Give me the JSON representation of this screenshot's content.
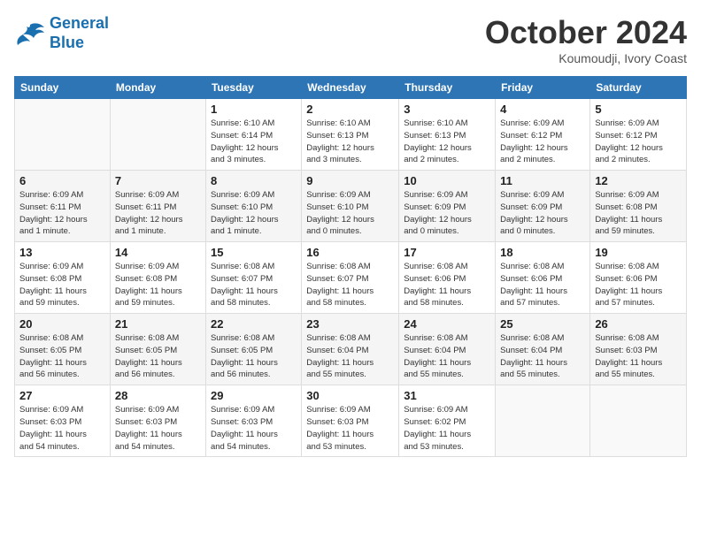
{
  "logo": {
    "line1": "General",
    "line2": "Blue"
  },
  "title": "October 2024",
  "subtitle": "Koumoudji, Ivory Coast",
  "days_of_week": [
    "Sunday",
    "Monday",
    "Tuesday",
    "Wednesday",
    "Thursday",
    "Friday",
    "Saturday"
  ],
  "weeks": [
    [
      {
        "day": "",
        "info": ""
      },
      {
        "day": "",
        "info": ""
      },
      {
        "day": "1",
        "info": "Sunrise: 6:10 AM\nSunset: 6:14 PM\nDaylight: 12 hours\nand 3 minutes."
      },
      {
        "day": "2",
        "info": "Sunrise: 6:10 AM\nSunset: 6:13 PM\nDaylight: 12 hours\nand 3 minutes."
      },
      {
        "day": "3",
        "info": "Sunrise: 6:10 AM\nSunset: 6:13 PM\nDaylight: 12 hours\nand 2 minutes."
      },
      {
        "day": "4",
        "info": "Sunrise: 6:09 AM\nSunset: 6:12 PM\nDaylight: 12 hours\nand 2 minutes."
      },
      {
        "day": "5",
        "info": "Sunrise: 6:09 AM\nSunset: 6:12 PM\nDaylight: 12 hours\nand 2 minutes."
      }
    ],
    [
      {
        "day": "6",
        "info": "Sunrise: 6:09 AM\nSunset: 6:11 PM\nDaylight: 12 hours\nand 1 minute."
      },
      {
        "day": "7",
        "info": "Sunrise: 6:09 AM\nSunset: 6:11 PM\nDaylight: 12 hours\nand 1 minute."
      },
      {
        "day": "8",
        "info": "Sunrise: 6:09 AM\nSunset: 6:10 PM\nDaylight: 12 hours\nand 1 minute."
      },
      {
        "day": "9",
        "info": "Sunrise: 6:09 AM\nSunset: 6:10 PM\nDaylight: 12 hours\nand 0 minutes."
      },
      {
        "day": "10",
        "info": "Sunrise: 6:09 AM\nSunset: 6:09 PM\nDaylight: 12 hours\nand 0 minutes."
      },
      {
        "day": "11",
        "info": "Sunrise: 6:09 AM\nSunset: 6:09 PM\nDaylight: 12 hours\nand 0 minutes."
      },
      {
        "day": "12",
        "info": "Sunrise: 6:09 AM\nSunset: 6:08 PM\nDaylight: 11 hours\nand 59 minutes."
      }
    ],
    [
      {
        "day": "13",
        "info": "Sunrise: 6:09 AM\nSunset: 6:08 PM\nDaylight: 11 hours\nand 59 minutes."
      },
      {
        "day": "14",
        "info": "Sunrise: 6:09 AM\nSunset: 6:08 PM\nDaylight: 11 hours\nand 59 minutes."
      },
      {
        "day": "15",
        "info": "Sunrise: 6:08 AM\nSunset: 6:07 PM\nDaylight: 11 hours\nand 58 minutes."
      },
      {
        "day": "16",
        "info": "Sunrise: 6:08 AM\nSunset: 6:07 PM\nDaylight: 11 hours\nand 58 minutes."
      },
      {
        "day": "17",
        "info": "Sunrise: 6:08 AM\nSunset: 6:06 PM\nDaylight: 11 hours\nand 58 minutes."
      },
      {
        "day": "18",
        "info": "Sunrise: 6:08 AM\nSunset: 6:06 PM\nDaylight: 11 hours\nand 57 minutes."
      },
      {
        "day": "19",
        "info": "Sunrise: 6:08 AM\nSunset: 6:06 PM\nDaylight: 11 hours\nand 57 minutes."
      }
    ],
    [
      {
        "day": "20",
        "info": "Sunrise: 6:08 AM\nSunset: 6:05 PM\nDaylight: 11 hours\nand 56 minutes."
      },
      {
        "day": "21",
        "info": "Sunrise: 6:08 AM\nSunset: 6:05 PM\nDaylight: 11 hours\nand 56 minutes."
      },
      {
        "day": "22",
        "info": "Sunrise: 6:08 AM\nSunset: 6:05 PM\nDaylight: 11 hours\nand 56 minutes."
      },
      {
        "day": "23",
        "info": "Sunrise: 6:08 AM\nSunset: 6:04 PM\nDaylight: 11 hours\nand 55 minutes."
      },
      {
        "day": "24",
        "info": "Sunrise: 6:08 AM\nSunset: 6:04 PM\nDaylight: 11 hours\nand 55 minutes."
      },
      {
        "day": "25",
        "info": "Sunrise: 6:08 AM\nSunset: 6:04 PM\nDaylight: 11 hours\nand 55 minutes."
      },
      {
        "day": "26",
        "info": "Sunrise: 6:08 AM\nSunset: 6:03 PM\nDaylight: 11 hours\nand 55 minutes."
      }
    ],
    [
      {
        "day": "27",
        "info": "Sunrise: 6:09 AM\nSunset: 6:03 PM\nDaylight: 11 hours\nand 54 minutes."
      },
      {
        "day": "28",
        "info": "Sunrise: 6:09 AM\nSunset: 6:03 PM\nDaylight: 11 hours\nand 54 minutes."
      },
      {
        "day": "29",
        "info": "Sunrise: 6:09 AM\nSunset: 6:03 PM\nDaylight: 11 hours\nand 54 minutes."
      },
      {
        "day": "30",
        "info": "Sunrise: 6:09 AM\nSunset: 6:03 PM\nDaylight: 11 hours\nand 53 minutes."
      },
      {
        "day": "31",
        "info": "Sunrise: 6:09 AM\nSunset: 6:02 PM\nDaylight: 11 hours\nand 53 minutes."
      },
      {
        "day": "",
        "info": ""
      },
      {
        "day": "",
        "info": ""
      }
    ]
  ]
}
